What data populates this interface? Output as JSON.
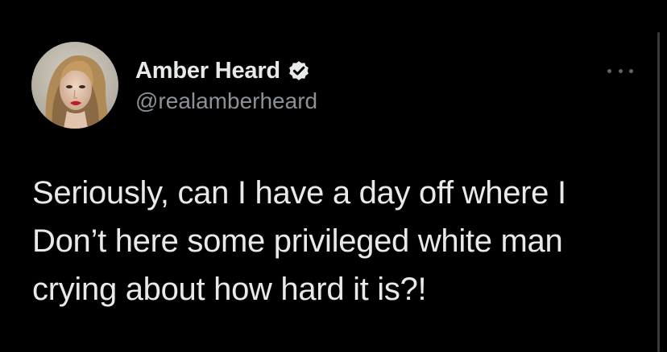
{
  "author": {
    "display_name": "Amber Heard",
    "handle": "@realamberheard",
    "verified": true,
    "avatar_icon": "profile-photo"
  },
  "tweet": {
    "lines": [
      "Seriously, can I have a day off where I",
      "Don’t here some privileged white man",
      "crying about how hard it is?!"
    ]
  },
  "icons": {
    "verified": "verified-badge-icon",
    "more": "more-options-icon"
  },
  "colors": {
    "background": "#000000",
    "text": "#e7e9ea",
    "secondary_text": "#8b9197"
  }
}
